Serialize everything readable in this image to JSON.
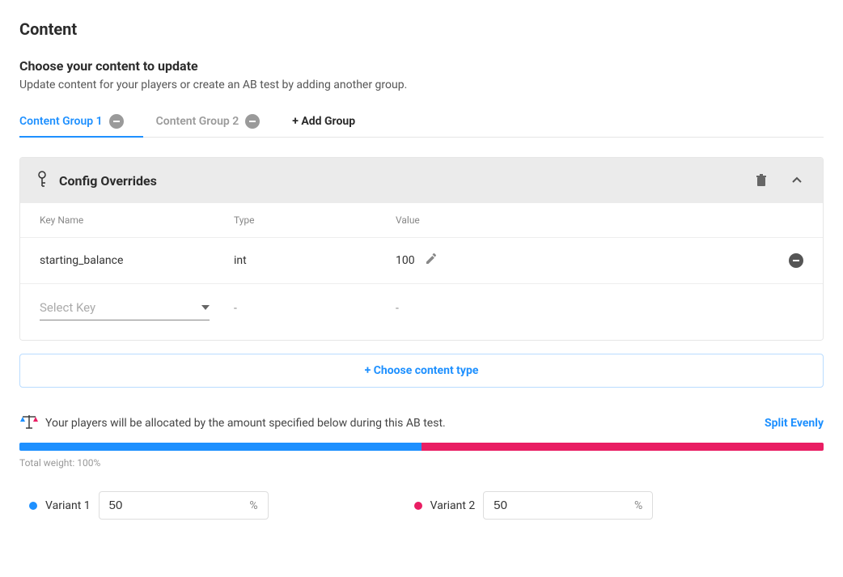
{
  "page": {
    "title": "Content",
    "section_title": "Choose your content to update",
    "section_sub": "Update content for your players or create an AB test by adding another group."
  },
  "tabs": {
    "group1": "Content Group 1",
    "group2": "Content Group 2",
    "add": "+ Add Group"
  },
  "panel": {
    "title": "Config Overrides",
    "columns": {
      "key": "Key Name",
      "type": "Type",
      "value": "Value"
    },
    "rows": [
      {
        "key": "starting_balance",
        "type": "int",
        "value": "100"
      }
    ],
    "select_key_placeholder": "Select Key",
    "empty": "-"
  },
  "choose_content": "+ Choose content type",
  "allocation": {
    "text": "Your players will be allocated by the amount specified below during this AB test.",
    "split_evenly": "Split Evenly",
    "total_weight": "Total weight: 100%",
    "variant1": {
      "label": "Variant 1",
      "value": "50",
      "pct": 50,
      "color": "#1e90ff"
    },
    "variant2": {
      "label": "Variant 2",
      "value": "50",
      "pct": 50,
      "color": "#e91e63"
    },
    "pct_sign": "%"
  }
}
